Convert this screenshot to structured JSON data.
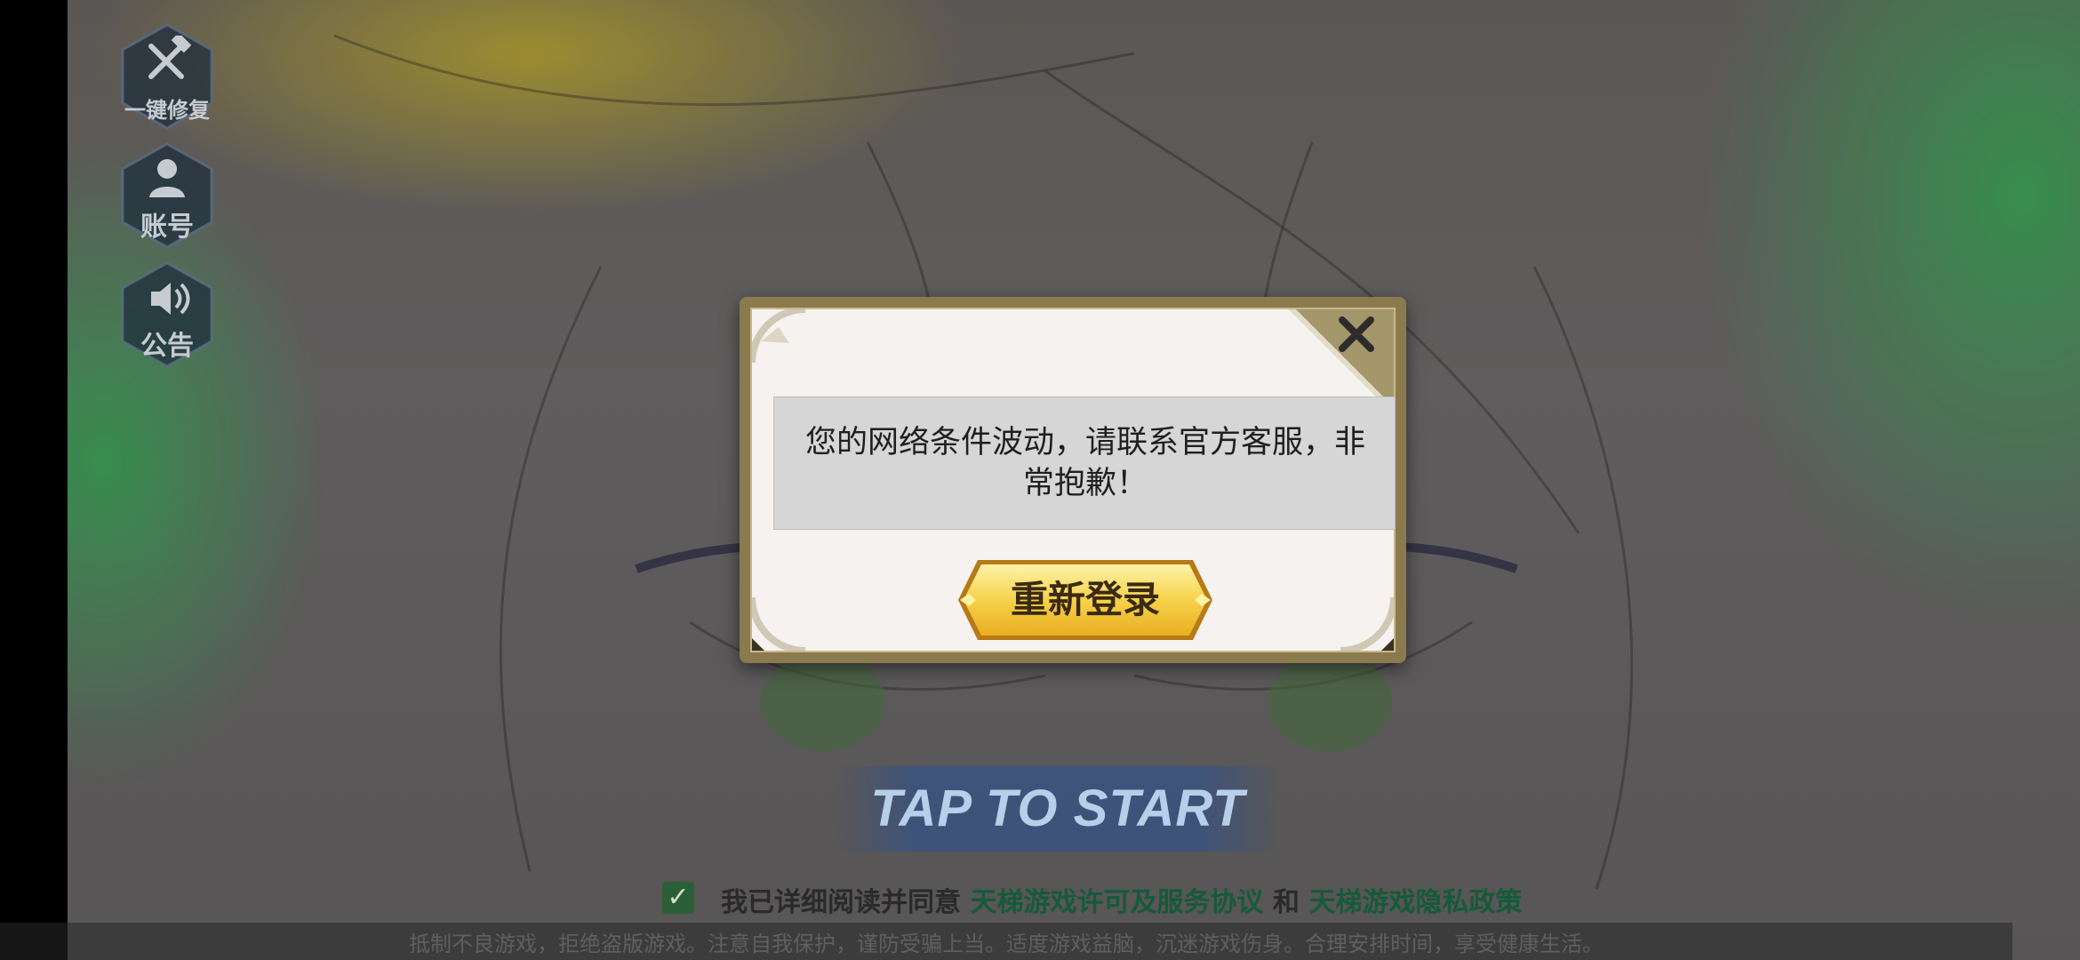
{
  "side_buttons": [
    {
      "label": "一键修复",
      "icon": "repair-tools-icon"
    },
    {
      "label": "账号",
      "icon": "user-icon"
    },
    {
      "label": "公告",
      "icon": "speaker-icon"
    }
  ],
  "start_prompt": "TAP TO START",
  "agreement": {
    "prefix": "我已详细阅读并同意",
    "link1": "天梯游戏许可及服务协议",
    "joiner": "和",
    "link2": "天梯游戏隐私政策",
    "checked": true
  },
  "footer": "抵制不良游戏，拒绝盗版游戏。注意自我保护，谨防受骗上当。适度游戏益脑，沉迷游戏伤身。合理安排时间，享受健康生活。",
  "dialog": {
    "message": "您的网络条件波动，请联系官方客服，非常抱歉！",
    "button_label": "重新登录",
    "close_icon": "close-icon"
  },
  "colors": {
    "dialog_frame": "#8b7a4e",
    "dialog_bg": "#f5f2f0",
    "button_gold": "#f5cf3e",
    "link_green": "#155a3b"
  }
}
